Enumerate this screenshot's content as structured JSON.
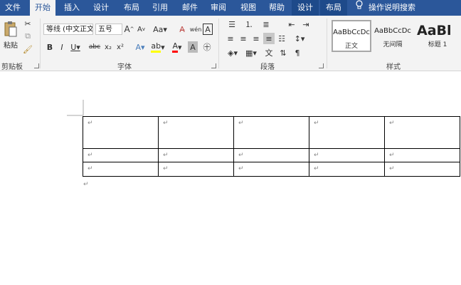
{
  "tabs": [
    "文件",
    "开始",
    "插入",
    "设计",
    "布局",
    "引用",
    "邮件",
    "审阅",
    "视图",
    "帮助",
    "设计",
    "布局",
    "操作说明搜索"
  ],
  "clipboard": {
    "paste_label": "粘贴",
    "group_label": "剪贴板"
  },
  "font": {
    "name": "等线 (中文正文)",
    "size": "五号",
    "group_label": "字体"
  },
  "paragraph": {
    "group_label": "段落"
  },
  "styles": {
    "group_label": "样式",
    "items": [
      {
        "preview": "AaBbCcDc",
        "name": "正文"
      },
      {
        "preview": "AaBbCcDc",
        "name": "无间隔"
      },
      {
        "preview": "AaBl",
        "name": "标题 1"
      }
    ]
  },
  "document": {
    "cell_mark": "↵",
    "table_rows": [
      [
        "↵",
        "↵",
        "↵",
        "↵",
        "↵"
      ],
      [
        "↵",
        "↵",
        "↵",
        "↵",
        "↵"
      ],
      [
        "↵",
        "↵",
        "↵",
        "↵",
        "↵"
      ]
    ],
    "after_mark": "↵"
  }
}
